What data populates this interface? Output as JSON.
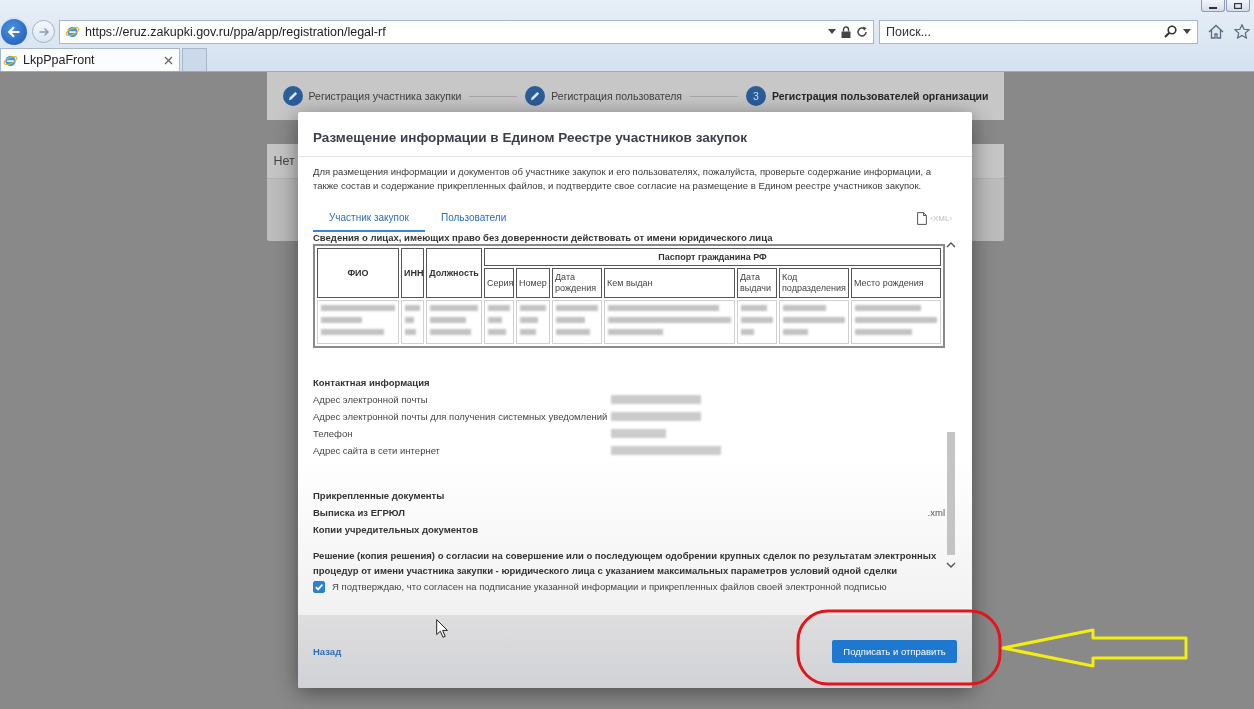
{
  "browser": {
    "address": {
      "url": "https://eruz.zakupki.gov.ru/ppa/app/registration/legal-rf"
    },
    "search": {
      "placeholder": "Поиск..."
    },
    "tabs": [
      {
        "title": "LkpPpaFront",
        "selected": true
      }
    ]
  },
  "stepper": {
    "steps": [
      {
        "label": "Регистрация участника закупки",
        "kind": "done"
      },
      {
        "label": "Регистрация пользователя",
        "kind": "done"
      },
      {
        "label": "Регистрация пользователей организации",
        "kind": "current",
        "number": "3"
      }
    ]
  },
  "background_card": {
    "text": "Нет"
  },
  "modal": {
    "title": "Размещение информации в Едином Реестре участников закупок",
    "description": "Для размещения информации и документов об участнике закупок и его пользователях, пожалуйста, проверьте содержание информации, а также состав и содержание прикрепленных файлов, и подтвердите свое согласие на размещение в Едином реестре участников закупок.",
    "tabs": [
      {
        "label": "Участник закупок",
        "selected": true
      },
      {
        "label": "Пользователи",
        "selected": false
      }
    ],
    "xml_button": {
      "label": "‹XML›",
      "disabled": true
    },
    "section_title": "Сведения о лицах, имеющих право без доверенности действовать от имени юридического лица",
    "table": {
      "columns": [
        "ФИО",
        "ИНН",
        "Должность"
      ],
      "group": {
        "label": "Паспорт гражданина РФ",
        "columns": [
          "Серия",
          "Номер",
          "Дата рождения",
          "Кем выдан",
          "Дата выдачи",
          "Код подразделения",
          "Место рождения"
        ]
      },
      "rows": [
        {
          "blurred": true
        }
      ]
    },
    "contacts": {
      "title": "Контактная информация",
      "items": [
        {
          "label": "Адрес электронной почты",
          "blurred": true
        },
        {
          "label": "Адрес электронной почты для получения системных уведомлений",
          "blurred": true
        },
        {
          "label": "Телефон",
          "blurred": true
        },
        {
          "label": "Адрес сайта в сети интернет",
          "blurred": true
        }
      ]
    },
    "attachments": {
      "title": "Прикрепленные документы",
      "items": [
        {
          "label": "Выписка из ЕГРЮЛ",
          "file": ".xml"
        },
        {
          "label": "Копии учредительных документов"
        },
        {
          "label": "Решение (копия решения) о согласии на совершение или о последующем одобрении крупных сделок по результатам электронных процедур от имени участника закупки - юридического лица с указанием максимальных параметров условий одной сделки"
        }
      ]
    },
    "consent": {
      "label": "Я подтверждаю, что согласен на подписание указанной информации и прикрепленных файлов своей электронной подписью",
      "checked": true
    },
    "back_link": "Назад",
    "submit_button": "Подписать и отправить"
  }
}
